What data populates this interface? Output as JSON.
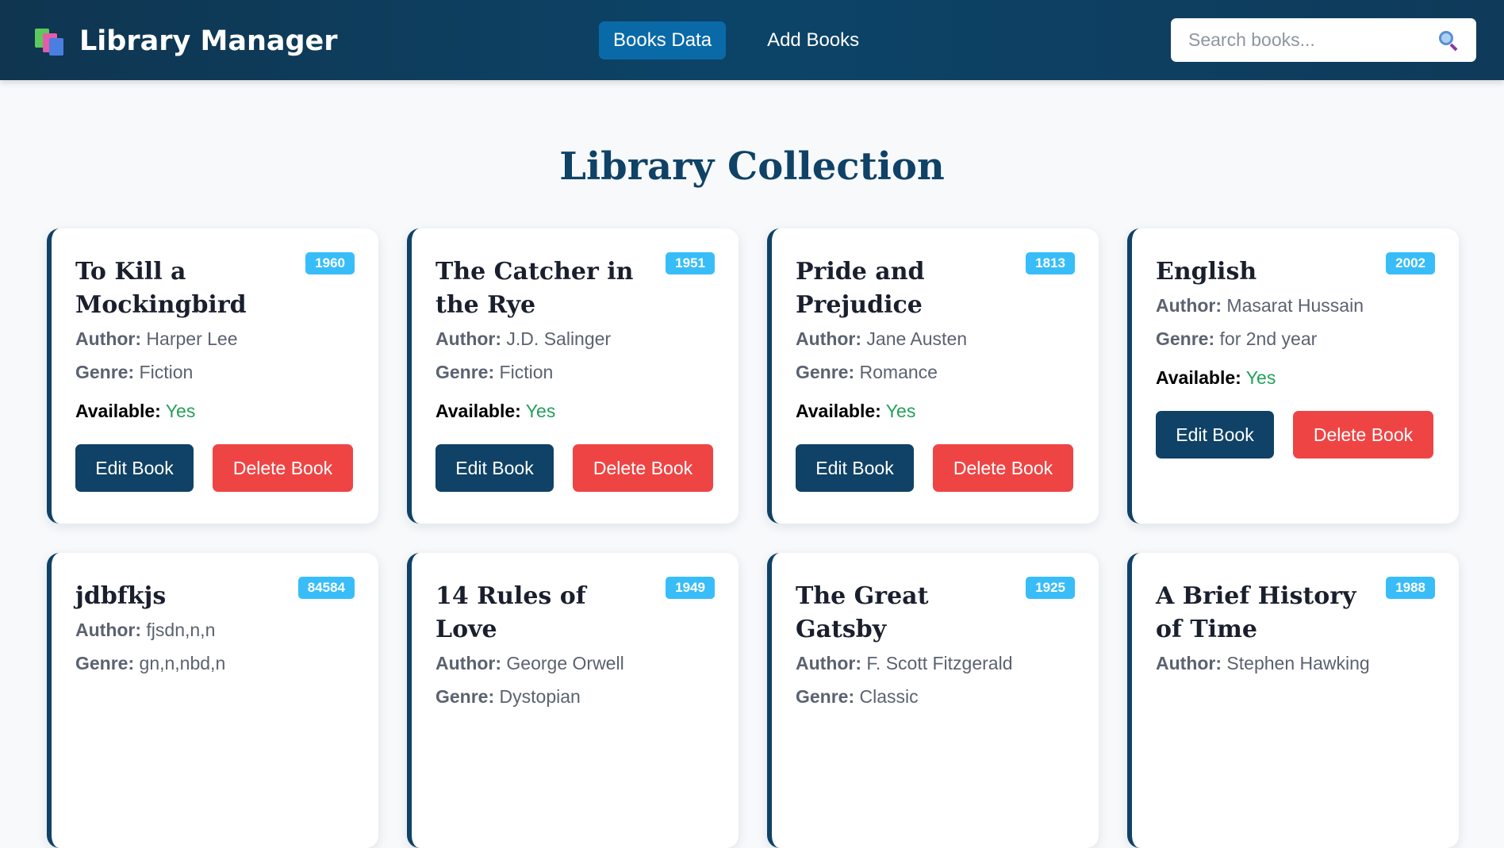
{
  "navbar": {
    "brand_title": "Library Manager",
    "links": [
      "Books Data",
      "Add Books"
    ],
    "active_link": "Books Data",
    "search_placeholder": "Search books..."
  },
  "page": {
    "title": "Library Collection"
  },
  "labels": {
    "author": "Author:",
    "genre": "Genre:",
    "available": "Available:",
    "edit": "Edit Book",
    "delete": "Delete Book"
  },
  "books": [
    {
      "title": "To Kill a Mockingbird",
      "year": "1960",
      "author": "Harper Lee",
      "genre": "Fiction",
      "available": "Yes"
    },
    {
      "title": "The Catcher in the Rye",
      "year": "1951",
      "author": "J.D. Salinger",
      "genre": "Fiction",
      "available": "Yes"
    },
    {
      "title": "Pride and Prejudice",
      "year": "1813",
      "author": "Jane Austen",
      "genre": "Romance",
      "available": "Yes"
    },
    {
      "title": "English",
      "year": "2002",
      "author": "Masarat Hussain",
      "genre": "for 2nd year",
      "available": "Yes"
    },
    {
      "title": "jdbfkjs",
      "year": "84584",
      "author": "fjsdn,n,n",
      "genre": "gn,n,nbd,n",
      "available": ""
    },
    {
      "title": "14 Rules of Love",
      "year": "1949",
      "author": "George Orwell",
      "genre": "Dystopian",
      "available": ""
    },
    {
      "title": "The Great Gatsby",
      "year": "1925",
      "author": "F. Scott Fitzgerald",
      "genre": "Classic",
      "available": ""
    },
    {
      "title": "A Brief History of Time",
      "year": "1988",
      "author": "Stephen Hawking",
      "genre": "",
      "available": ""
    }
  ],
  "colors": {
    "accent": "#0f4266",
    "badge": "#38bdf8",
    "danger": "#ef4444",
    "yes": "#22a05a"
  }
}
